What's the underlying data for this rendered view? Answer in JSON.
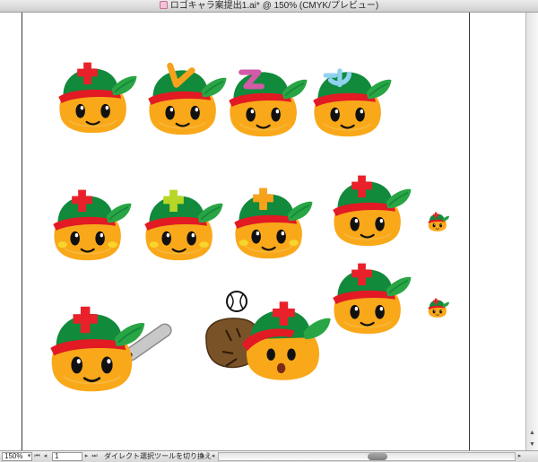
{
  "window": {
    "title": "ロゴキャラ案提出1.ai* @ 150% (CMYK/プレビュー)",
    "icon": "illustrator-document-icon"
  },
  "statusbar": {
    "zoom": "150%",
    "page": "1",
    "tool_status": "ダイレクト選択ツールを切り換え",
    "icons": [
      "first-artboard-icon",
      "prev-artboard-icon",
      "next-artboard-icon",
      "last-artboard-icon",
      "status-menu-icon",
      "scroll-left-icon",
      "scroll-right-icon"
    ]
  },
  "colors": {
    "orange": "#f9a81a",
    "cap_green": "#118a3c",
    "brim_red": "#e11a24",
    "leaf_green": "#2aa545",
    "cross_red": "#e8212a",
    "cross_lime": "#b8d626",
    "cross_orange": "#f7a21b",
    "glove_brown": "#7a5228",
    "bat_gray": "#c8c8c8"
  },
  "mascots": [
    {
      "id": "row1-red-cross",
      "accessory": "red-cross"
    },
    {
      "id": "row1-orange-v",
      "accessory": "orange-v"
    },
    {
      "id": "row1-magenta-z",
      "accessory": "magenta-z"
    },
    {
      "id": "row1-cyan-squiggle",
      "accessory": "cyan-squiggle"
    },
    {
      "id": "row2-red-cross",
      "accessory": "red-cross"
    },
    {
      "id": "row2-lime-cross",
      "accessory": "lime-cross"
    },
    {
      "id": "row2-orange-cross",
      "accessory": "orange-cross"
    },
    {
      "id": "row2-red-cross-simple",
      "accessory": "red-cross"
    },
    {
      "id": "row2-small",
      "accessory": "red-cross"
    },
    {
      "id": "row3-red-cross",
      "accessory": "red-cross"
    },
    {
      "id": "row3-small",
      "accessory": "red-cross"
    },
    {
      "id": "with-bat",
      "accessory": "baseball-bat"
    },
    {
      "id": "with-glove",
      "accessory": "glove-and-ball"
    }
  ]
}
